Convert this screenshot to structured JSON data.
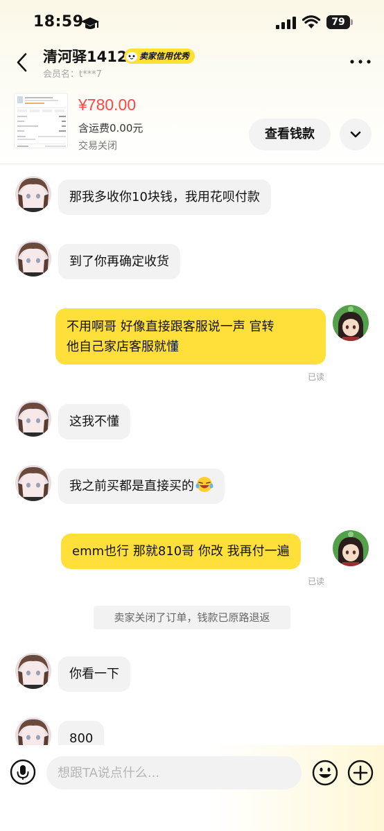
{
  "status_bar": {
    "time": "18:59",
    "battery": "79"
  },
  "header": {
    "seller_name": "清河驿1412",
    "credit_badge": "卖家信用优秀",
    "member_label": "会员名：",
    "member_id": "t***7"
  },
  "product": {
    "price": "¥780.00",
    "shipping": "含运费0.00元",
    "status": "交易关闭",
    "view_button": "查看钱款"
  },
  "messages": [
    {
      "side": "in",
      "text": "那我多收你10块钱，我用花呗付款"
    },
    {
      "side": "in",
      "text": "到了你再确定收货"
    },
    {
      "side": "out",
      "lines": [
        "不用啊哥 好像直接跟客服说一声 官转",
        "他自己家店客服就懂"
      ],
      "read": "已读"
    },
    {
      "side": "in",
      "text": "这我不懂"
    },
    {
      "side": "in",
      "text": "我之前买都是直接买的"
    },
    {
      "side": "out",
      "text": "emm也行 那就810哥 你改 我再付一遍",
      "read": "已读"
    },
    {
      "system": "卖家关闭了订单，钱款已原路退返"
    },
    {
      "side": "in",
      "text": "你看一下"
    },
    {
      "side": "in",
      "text": "800"
    }
  ],
  "input": {
    "placeholder": "想跟TA说点什么..."
  },
  "icons": {
    "back": "back-arrow-icon",
    "more": "more-icon",
    "voice": "microphone-icon",
    "emoji": "emoji-icon",
    "plus": "plus-icon",
    "expand": "chevron-down-icon"
  },
  "colors": {
    "accent": "#ffe03b",
    "price": "#ff4444"
  }
}
